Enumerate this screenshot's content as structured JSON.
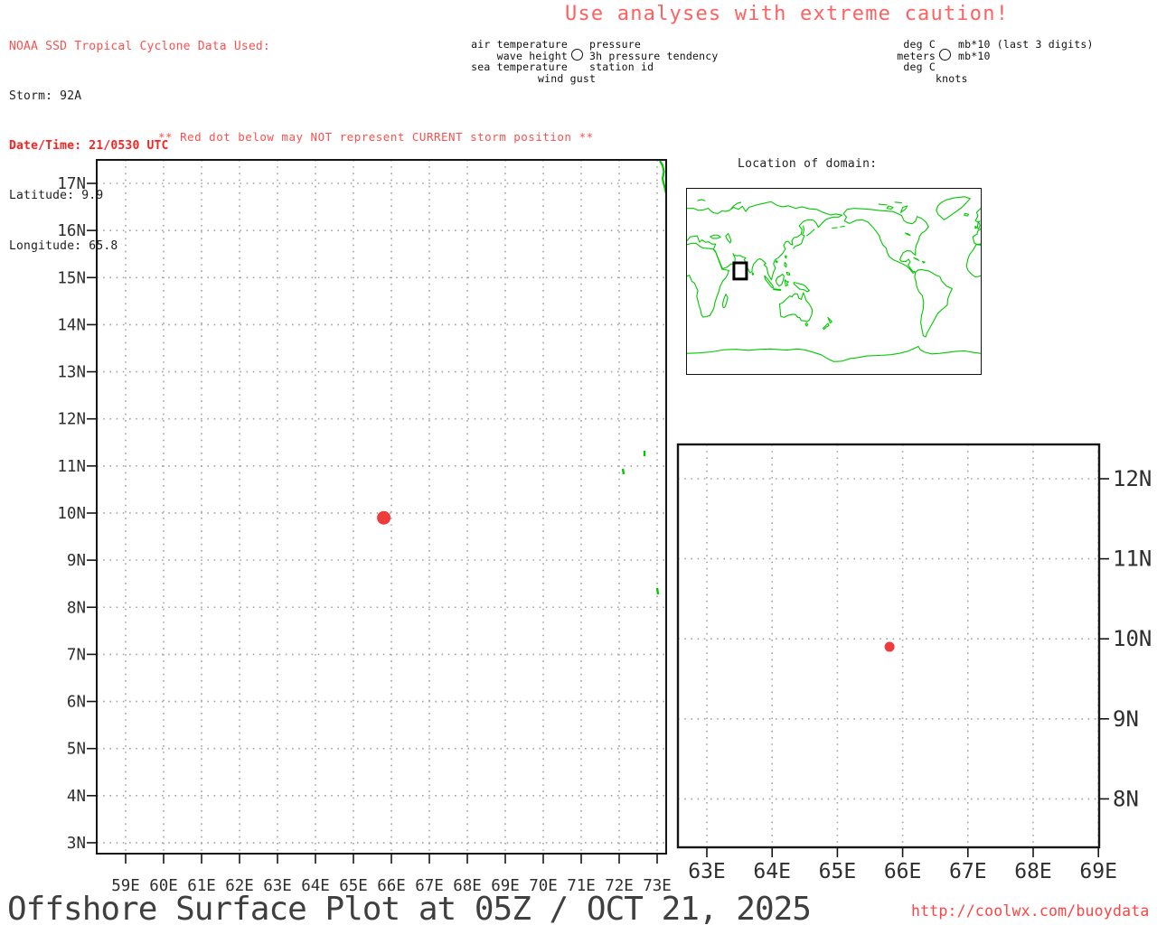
{
  "colors": {
    "alert_red": "#ff5050",
    "bold_red": "#ff1f1f",
    "storm_dot_red": "#ee3b3b",
    "coastline_green": "#00c800",
    "grid_gray": "#a3a3a3"
  },
  "header": {
    "cyclone_info": {
      "title": "NOAA SSD Tropical Cyclone Data Used:",
      "storm": "Storm: 92A",
      "datetime": "Date/Time: 21/0530 UTC",
      "latitude": "Latitude: 9.9",
      "longitude": "Longitude: 65.8"
    },
    "caution": "Use analyses with extreme caution!"
  },
  "station_model_legend": {
    "left_labels": [
      "air temperature",
      "wave height",
      "sea temperature"
    ],
    "right_labels": [
      "pressure",
      "3h pressure tendency",
      "station id"
    ],
    "bottom_label": "wind gust"
  },
  "units_legend": {
    "left_labels": [
      "deg C",
      "meters",
      "deg C"
    ],
    "right_labels": [
      "mb*10 (last 3 digits)",
      "mb*10"
    ],
    "bottom_label": "knots"
  },
  "storm_warning": "** Red dot below may NOT represent CURRENT storm position **",
  "inset_map": {
    "label": "Location of domain:"
  },
  "footer": {
    "title": "Offshore Surface Plot at 05Z / OCT 21, 2025",
    "url": "http://coolwx.com/buoydata"
  },
  "chart_data": [
    {
      "type": "scatter",
      "name": "main-plot",
      "title": "",
      "x_tick_labels": [
        "59E",
        "60E",
        "61E",
        "62E",
        "63E",
        "64E",
        "65E",
        "66E",
        "67E",
        "68E",
        "69E",
        "70E",
        "71E",
        "72E",
        "73E"
      ],
      "y_tick_labels": [
        "17N",
        "16N",
        "15N",
        "14N",
        "13N",
        "12N",
        "11N",
        "10N",
        "9N",
        "8N",
        "7N",
        "6N",
        "5N",
        "4N",
        "3N"
      ],
      "xlim_deg_e": [
        58.25,
        73.25
      ],
      "ylim_deg_n": [
        2.75,
        17.5
      ],
      "grid": "dotted 1-degree gray grid",
      "points": [
        {
          "name": "storm-92A-position",
          "lon_e": 65.8,
          "lat_n": 9.9,
          "color": "#ee3b3b"
        }
      ]
    },
    {
      "type": "scatter",
      "name": "zoom-plot",
      "title": "",
      "x_tick_labels": [
        "63E",
        "64E",
        "65E",
        "66E",
        "67E",
        "68E",
        "69E"
      ],
      "y_tick_labels": [
        "12N",
        "11N",
        "10N",
        "9N",
        "8N"
      ],
      "xlim_deg_e": [
        62.56,
        69.02
      ],
      "ylim_deg_n": [
        7.45,
        12.43
      ],
      "grid": "dotted 1-degree gray grid",
      "points": [
        {
          "name": "storm-92A-position",
          "lon_e": 65.8,
          "lat_n": 9.9,
          "color": "#ee3b3b"
        }
      ]
    }
  ]
}
